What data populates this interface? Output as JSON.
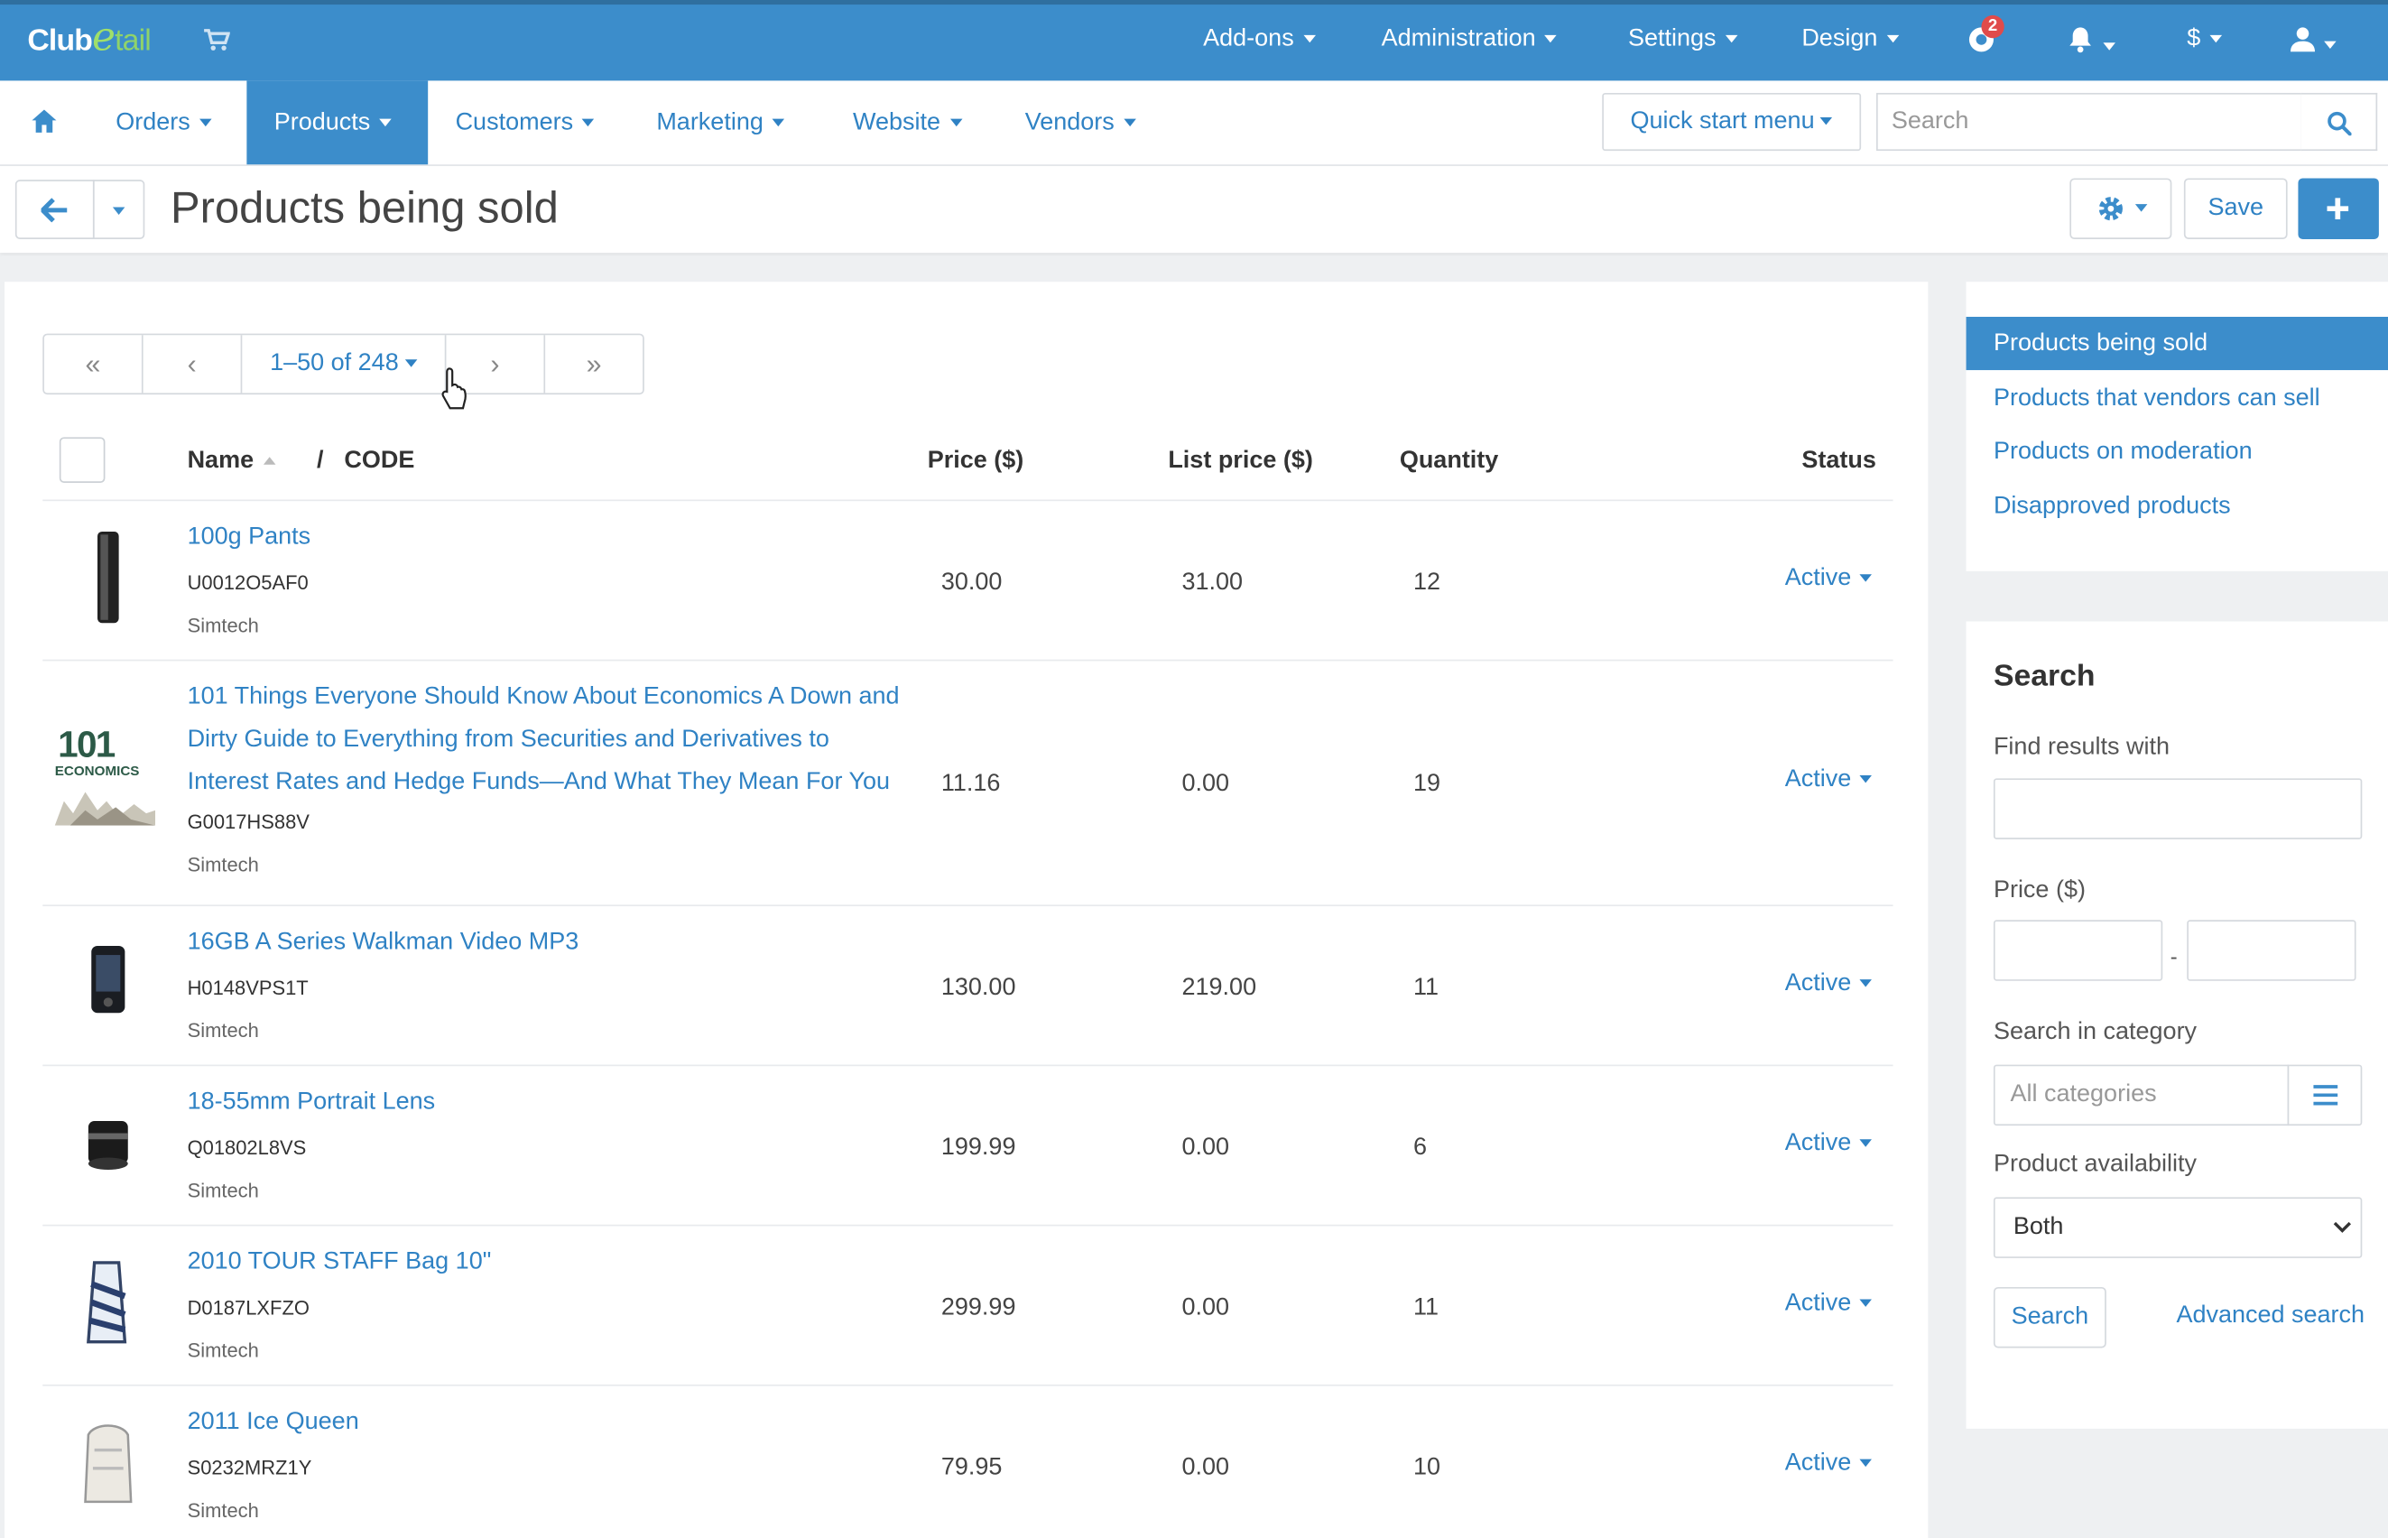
{
  "brand": {
    "logo_part1": "Club",
    "logo_part2": "e",
    "logo_part3": "tail"
  },
  "topbar": {
    "menus": [
      "Add-ons",
      "Administration",
      "Settings",
      "Design"
    ],
    "notifications_count": "2",
    "currency": "$"
  },
  "nav": {
    "items": [
      "Orders",
      "Products",
      "Customers",
      "Marketing",
      "Website",
      "Vendors"
    ],
    "active": "Products",
    "quick_start": "Quick start menu",
    "search_placeholder": "Search"
  },
  "titlebar": {
    "title": "Products being sold",
    "save": "Save"
  },
  "pager": {
    "range": "1–50 of 248",
    "first": "«",
    "prev": "‹",
    "next": "›",
    "last": "»"
  },
  "table": {
    "headers": {
      "name": "Name",
      "separator": "/",
      "code": "CODE",
      "price": "Price ($)",
      "list_price": "List price ($)",
      "quantity": "Quantity",
      "status": "Status"
    },
    "rows": [
      {
        "name": "100g Pants",
        "code": "U0012O5AF0",
        "vendor": "Simtech",
        "price": "30.00",
        "list_price": "31.00",
        "quantity": "12",
        "status": "Active"
      },
      {
        "name": "101 Things Everyone Should Know About Economics A Down and Dirty Guide to Everything from Securities and Derivatives to Interest Rates and Hedge Funds—And What They Mean For You",
        "code": "G0017HS88V",
        "vendor": "Simtech",
        "price": "11.16",
        "list_price": "0.00",
        "quantity": "19",
        "status": "Active"
      },
      {
        "name": "16GB A Series Walkman Video MP3",
        "code": "H0148VPS1T",
        "vendor": "Simtech",
        "price": "130.00",
        "list_price": "219.00",
        "quantity": "11",
        "status": "Active"
      },
      {
        "name": "18-55mm Portrait Lens",
        "code": "Q01802L8VS",
        "vendor": "Simtech",
        "price": "199.99",
        "list_price": "0.00",
        "quantity": "6",
        "status": "Active"
      },
      {
        "name": "2010 TOUR STAFF Bag 10\"",
        "code": "D0187LXFZO",
        "vendor": "Simtech",
        "price": "299.99",
        "list_price": "0.00",
        "quantity": "11",
        "status": "Active"
      },
      {
        "name": "2011 Ice Queen",
        "code": "S0232MRZ1Y",
        "vendor": "Simtech",
        "price": "79.95",
        "list_price": "0.00",
        "quantity": "10",
        "status": "Active"
      }
    ],
    "thumb_book_text": {
      "big": "101",
      "sub": "ECONOMICS"
    }
  },
  "sidebar": {
    "views": [
      "Products being sold",
      "Products that vendors can sell",
      "Products on moderation",
      "Disapproved products"
    ],
    "search": {
      "title": "Search",
      "find_label": "Find results with",
      "price_label": "Price ($)",
      "price_sep": "-",
      "category_label": "Search in category",
      "category_placeholder": "All categories",
      "availability_label": "Product availability",
      "availability_value": "Both",
      "search_button": "Search",
      "advanced_link": "Advanced search"
    }
  },
  "colors": {
    "primary": "#3c8dcb",
    "link": "#2f82c4",
    "badge": "#e04b4b"
  }
}
